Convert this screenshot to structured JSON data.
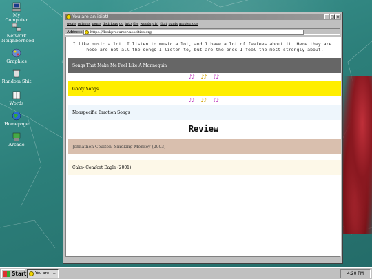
{
  "desktop": {
    "icons": [
      {
        "label": "My Computer",
        "icon": "computer-icon"
      },
      {
        "label": "Network Neighborhood",
        "icon": "network-icon"
      },
      {
        "label": "Graphics",
        "icon": "graphics-icon"
      },
      {
        "label": "Random Shit",
        "icon": "recycle-bin-icon"
      },
      {
        "label": "Words",
        "icon": "book-icon"
      },
      {
        "label": "Homepage",
        "icon": "globe-icon"
      },
      {
        "label": "Arcade",
        "icon": "arcade-icon"
      }
    ]
  },
  "window": {
    "title": "You are an idiot!",
    "menu": [
      "goats",
      "prisons",
      "penis",
      "delirious",
      "go",
      "into",
      "the",
      "woods",
      "girl",
      "that",
      "pagis",
      "mysterious"
    ],
    "address_label": "Address",
    "address_value": "https://flesbprecursor.neocities.org",
    "buttons": {
      "minimize": "_",
      "maximize": "□",
      "close": "×"
    }
  },
  "page": {
    "intro_line1": "I like music a lot. I listen to music a lot, and I have a lot of feefees about it. Here they are!",
    "intro_line2": "These are not all the songs I listen to, but are the ones I feel the most strongly about.",
    "sections": [
      {
        "label": "Songs That Make Me Feel Like A Mannequin",
        "bg": "#666666",
        "fg": "#ffffff"
      },
      {
        "label": "Goofy Songs",
        "bg": "#ffee00",
        "fg": "#000000"
      },
      {
        "label": "Nonspecific Emotion Songs",
        "bg": "#eef6fc",
        "fg": "#000000"
      }
    ],
    "notes_glyph": "♪♪",
    "review_heading": "Review",
    "reviews": [
      {
        "label": "Johnathon Coulton- Smoking Monkey (2003)",
        "bg": "#d9bfae",
        "fg": "#444444"
      },
      {
        "label": "Cake- Comfort Eagle (2001)",
        "bg": "#fdf8e8",
        "fg": "#000000"
      }
    ]
  },
  "taskbar": {
    "start_label": "Start",
    "task_label": "You are - ...",
    "clock": "4:20 PM"
  }
}
